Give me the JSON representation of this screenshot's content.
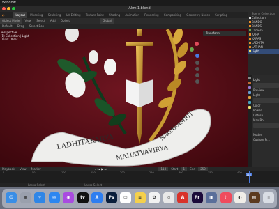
{
  "menubar": {
    "app_menu": "Window"
  },
  "window": {
    "title": "Akmi1.blend"
  },
  "topbar": {
    "workspaces": [
      "Layout",
      "Modeling",
      "Sculpting",
      "UV Editing",
      "Texture Paint",
      "Shading",
      "Animation",
      "Rendering",
      "Compositing",
      "Geometry Nodes",
      "Scripting"
    ],
    "active_workspace": "Layout",
    "scene_label": "Scene",
    "view_layer_label": "ViewLayer"
  },
  "header": {
    "mode": "Object Mode",
    "menus": [
      "View",
      "Select",
      "Add",
      "Object"
    ],
    "orientation_label": "Global"
  },
  "header2": {
    "orientation": "Default",
    "drag": "Drag",
    "select": "Select Box"
  },
  "viewport": {
    "info_lines": [
      "Perspective",
      "(1) Collection | Light",
      "Units: Ohms"
    ],
    "transform_panel_label": "Transform",
    "scroll_text": [
      "LADHITAKARYA",
      "MAHATVAVIRYA",
      "NAGARAMRIT"
    ]
  },
  "outliner": {
    "title": "Scene Collection",
    "items": [
      {
        "label": "Collection",
        "selected": false
      },
      {
        "label": "BANDO",
        "selected": false
      },
      {
        "label": "BANDS",
        "selected": false
      },
      {
        "label": "Camera",
        "selected": false
      },
      {
        "label": "KARA",
        "selected": false
      },
      {
        "label": "KARAS",
        "selected": false
      },
      {
        "label": "LADHITA",
        "selected": false
      },
      {
        "label": "LATHAN",
        "selected": false
      },
      {
        "label": "Light",
        "selected": true
      }
    ]
  },
  "properties": {
    "object": "Light",
    "sections": [
      "Preview",
      "Light",
      "Color",
      "Power",
      "Diffuse",
      "Max Bo...",
      "Nodes",
      "Custom Pr..."
    ]
  },
  "timeline": {
    "menus": [
      "Playback",
      "View",
      "Marker"
    ],
    "current_frame": "118",
    "start_label": "Start",
    "start": "1",
    "end_label": "End",
    "end": "250",
    "ticks": [
      "0",
      "50",
      "100",
      "150",
      "200",
      "250",
      "300",
      "350",
      "400"
    ]
  },
  "status": {
    "left": "Lasso Select",
    "right": "Lasso Select"
  },
  "dock": {
    "apps": [
      {
        "name": "Finder",
        "color": "#3a8ee6",
        "glyph": "☺"
      },
      {
        "name": "Launchpad",
        "color": "#9aa0ad",
        "glyph": "▦"
      },
      {
        "name": "Safari",
        "color": "#2f86e6",
        "glyph": "✧"
      },
      {
        "name": "Mail",
        "color": "#2c86f0",
        "glyph": "✉"
      },
      {
        "name": "Podcasts",
        "color": "#a94be0",
        "glyph": "◉"
      },
      {
        "name": "Apple TV",
        "color": "#111111",
        "glyph": "tv"
      },
      {
        "name": "App Store",
        "color": "#2e7ef0",
        "glyph": "A"
      },
      {
        "name": "Photoshop",
        "color": "#0b1e3b",
        "glyph": "Ps"
      },
      {
        "name": "Calendar",
        "color": "#ffffff",
        "glyph": "▭"
      },
      {
        "name": "Notes",
        "color": "#f5d04c",
        "glyph": "≡"
      },
      {
        "name": "Photos",
        "color": "#f2f2f2",
        "glyph": "✿"
      },
      {
        "name": "Chrome",
        "color": "#e8e8e8",
        "glyph": "◎"
      },
      {
        "name": "Acrobat",
        "color": "#d8322a",
        "glyph": "A"
      },
      {
        "name": "Premiere Pro",
        "color": "#1b0a3a",
        "glyph": "Pr"
      },
      {
        "name": "Preview",
        "color": "#5a6f9a",
        "glyph": "▣"
      },
      {
        "name": "Music",
        "color": "#f04b5d",
        "glyph": "♪"
      },
      {
        "name": "Blender",
        "color": "#f0eee8",
        "glyph": "◐"
      },
      {
        "name": "Finder Window",
        "color": "#5b3a1f",
        "glyph": "▤"
      },
      {
        "name": "Trash",
        "color": "#d9dde4",
        "glyph": "▯"
      }
    ]
  }
}
